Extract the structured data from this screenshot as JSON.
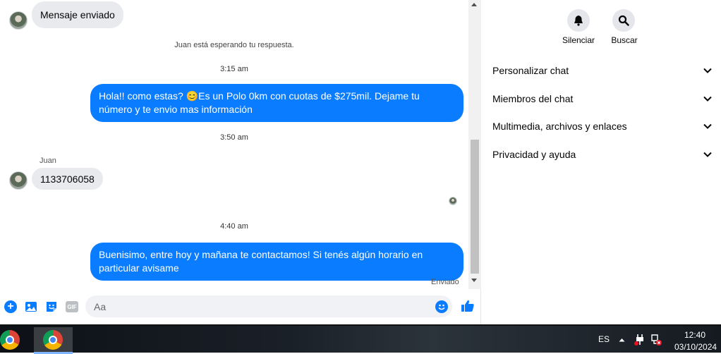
{
  "chat": {
    "top_message": "Mensaje enviado",
    "waiting_notice": "Juan está esperando tu respuesta.",
    "time1": "3:15 am",
    "outgoing1": "Hola!! como estas? 😊Es un Polo 0km con cuotas de $275mil. Dejame tu número y te envio mas información",
    "time2": "3:50 am",
    "sender_name": "Juan",
    "incoming1": "1133706058",
    "time3": "4:40 am",
    "outgoing2": "Buenisimo, entre hoy y mañana te contactamos! Si tenés algún horario en particular avisame",
    "sent_status": "Enviado"
  },
  "composer": {
    "placeholder": "Aa",
    "gif_label": "GIF",
    "icons": [
      "plus-icon",
      "image-icon",
      "sticker-icon",
      "gif-icon",
      "emoji-icon",
      "thumbs-up-icon"
    ]
  },
  "sidebar": {
    "mute_label": "Silenciar",
    "search_label": "Buscar",
    "sections": [
      {
        "label": "Personalizar chat"
      },
      {
        "label": "Miembros del chat"
      },
      {
        "label": "Multimedia, archivos y enlaces"
      },
      {
        "label": "Privacidad y ayuda"
      }
    ]
  },
  "taskbar": {
    "language": "ES",
    "time": "12:40",
    "date": "03/10/2024"
  },
  "colors": {
    "accent": "#0a7cff",
    "incoming_bubble": "#e9eaee"
  }
}
